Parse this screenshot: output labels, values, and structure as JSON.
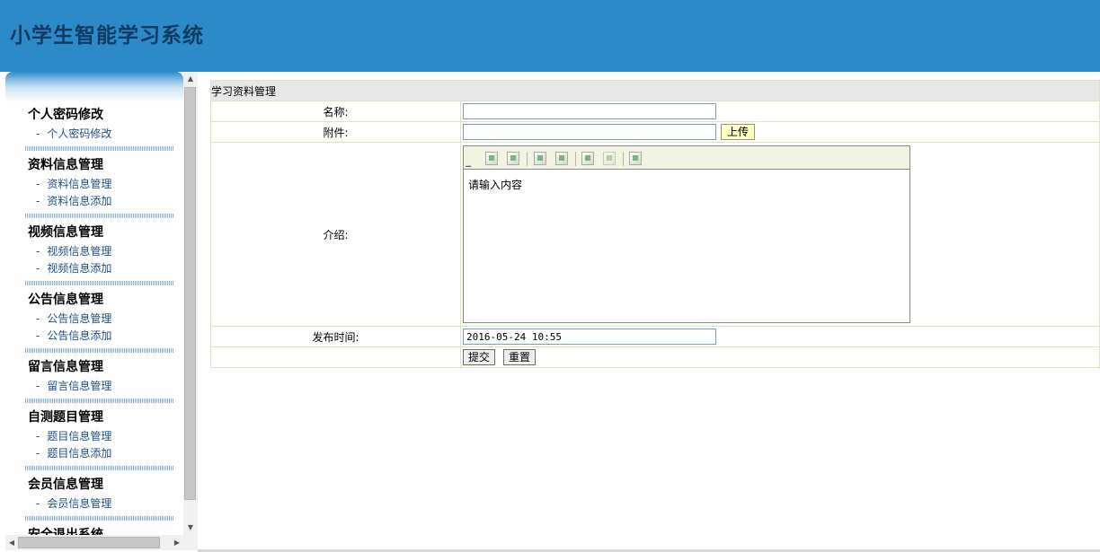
{
  "app": {
    "title": "小学生智能学习系统"
  },
  "sidebar": {
    "groups": [
      {
        "title": "个人密码修改",
        "items": [
          "个人密码修改"
        ]
      },
      {
        "title": "资料信息管理",
        "items": [
          "资料信息管理",
          "资料信息添加"
        ]
      },
      {
        "title": "视频信息管理",
        "items": [
          "视频信息管理",
          "视频信息添加"
        ]
      },
      {
        "title": "公告信息管理",
        "items": [
          "公告信息管理",
          "公告信息添加"
        ]
      },
      {
        "title": "留言信息管理",
        "items": [
          "留言信息管理"
        ]
      },
      {
        "title": "自测题目管理",
        "items": [
          "题目信息管理",
          "题目信息添加"
        ]
      },
      {
        "title": "会员信息管理",
        "items": [
          "会员信息管理"
        ]
      },
      {
        "title": "安全退出系统",
        "items": []
      }
    ],
    "item_prefix": "-"
  },
  "form": {
    "caption": "学习资料管理",
    "name_label": "名称:",
    "name_value": "",
    "attachment_label": "附件:",
    "attachment_value": "",
    "upload_label": "上传",
    "intro_label": "介绍:",
    "editor_placeholder": "请输入内容",
    "publish_time_label": "发布时间:",
    "publish_time_value": "2016-05-24 10:55",
    "submit_label": "提交",
    "reset_label": "重置"
  },
  "editor_toolbar": {
    "icons": [
      "grip-icon",
      "image-icon",
      "image-icon",
      "table-icon",
      "table-icon",
      "media-icon",
      "media-icon",
      "source-icon"
    ]
  },
  "colors": {
    "header_bg": "#2d8ac8",
    "title_text": "#113b63",
    "menu_link": "#1f4f88",
    "caption_bg": "#e7e7e7",
    "upload_bg": "#ffffc8"
  }
}
